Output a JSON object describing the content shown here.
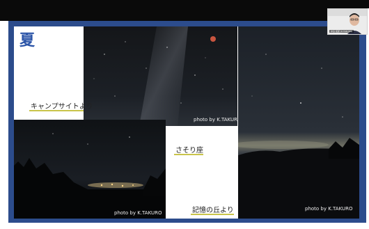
{
  "slide": {
    "title": "夏",
    "captions": {
      "camp": "キャンプサイトより",
      "scorpion": "さそり座",
      "hill": "記憶の丘より"
    },
    "credits": {
      "top_center": "photo by K.TAKURO",
      "bottom_left": "photo by K.TAKURO",
      "right": "photo by K.TAKURO"
    }
  },
  "webcam": {
    "participant_name": "中島 拓郎 (K.TAKURO)"
  },
  "colors": {
    "slide_frame": "#2c4c8c",
    "title_blue": "#2c55a8",
    "caption_underline": "#c9c44a",
    "night_sky": "#1a1f26"
  }
}
